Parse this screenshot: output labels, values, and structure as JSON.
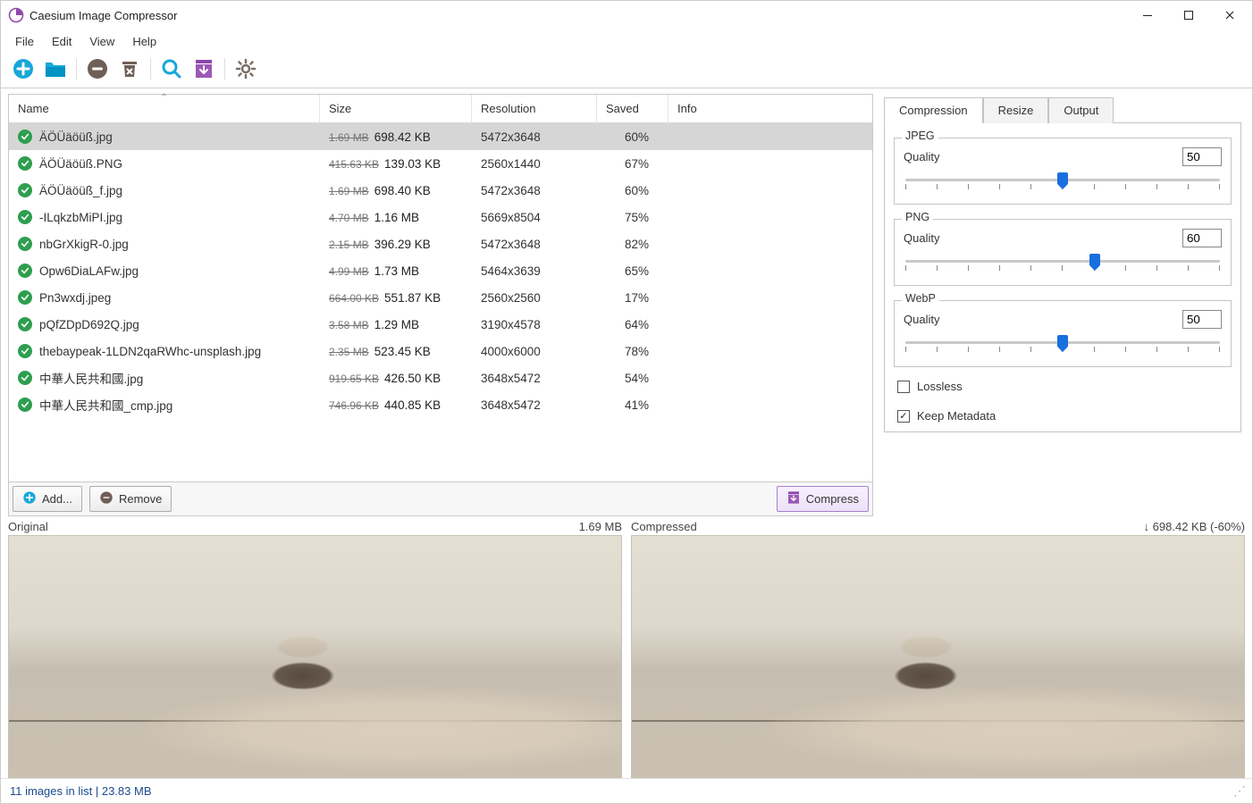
{
  "window": {
    "title": "Caesium Image Compressor"
  },
  "menu": {
    "items": [
      "File",
      "Edit",
      "View",
      "Help"
    ]
  },
  "table": {
    "headers": {
      "name": "Name",
      "size": "Size",
      "resolution": "Resolution",
      "saved": "Saved",
      "info": "Info"
    },
    "rows": [
      {
        "name": "ÄÖÜäöüß.jpg",
        "orig": "1.69 MB",
        "new": "698.42 KB",
        "res": "5472x3648",
        "saved": "60%",
        "selected": true
      },
      {
        "name": "ÄÖÜäöüß.PNG",
        "orig": "415.63 KB",
        "new": "139.03 KB",
        "res": "2560x1440",
        "saved": "67%"
      },
      {
        "name": "ÄÖÜäöüß_f.jpg",
        "orig": "1.69 MB",
        "new": "698.40 KB",
        "res": "5472x3648",
        "saved": "60%"
      },
      {
        "name": "-ILqkzbMiPI.jpg",
        "orig": "4.70 MB",
        "new": "1.16 MB",
        "res": "5669x8504",
        "saved": "75%"
      },
      {
        "name": "nbGrXkigR-0.jpg",
        "orig": "2.15 MB",
        "new": "396.29 KB",
        "res": "5472x3648",
        "saved": "82%"
      },
      {
        "name": "Opw6DiaLAFw.jpg",
        "orig": "4.99 MB",
        "new": "1.73 MB",
        "res": "5464x3639",
        "saved": "65%"
      },
      {
        "name": "Pn3wxdj.jpeg",
        "orig": "664.00 KB",
        "new": "551.87 KB",
        "res": "2560x2560",
        "saved": "17%"
      },
      {
        "name": "pQfZDpD692Q.jpg",
        "orig": "3.58 MB",
        "new": "1.29 MB",
        "res": "3190x4578",
        "saved": "64%"
      },
      {
        "name": "thebaypeak-1LDN2qaRWhc-unsplash.jpg",
        "orig": "2.35 MB",
        "new": "523.45 KB",
        "res": "4000x6000",
        "saved": "78%"
      },
      {
        "name": "中華人民共和國.jpg",
        "orig": "919.65 KB",
        "new": "426.50 KB",
        "res": "3648x5472",
        "saved": "54%"
      },
      {
        "name": "中華人民共和國_cmp.jpg",
        "orig": "746.96 KB",
        "new": "440.85 KB",
        "res": "3648x5472",
        "saved": "41%"
      }
    ]
  },
  "actions": {
    "add": "Add...",
    "remove": "Remove",
    "compress": "Compress"
  },
  "tabs": {
    "compression": "Compression",
    "resize": "Resize",
    "output": "Output",
    "active": "compression"
  },
  "compression": {
    "jpeg": {
      "legend": "JPEG",
      "quality_label": "Quality",
      "quality": "50"
    },
    "png": {
      "legend": "PNG",
      "quality_label": "Quality",
      "quality": "60"
    },
    "webp": {
      "legend": "WebP",
      "quality_label": "Quality",
      "quality": "50"
    },
    "lossless": {
      "label": "Lossless",
      "checked": false
    },
    "metadata": {
      "label": "Keep Metadata",
      "checked": true
    }
  },
  "preview": {
    "left_label": "Original",
    "left_value": "1.69 MB",
    "right_label": "Compressed",
    "right_value": "↓ 698.42 KB (-60%)"
  },
  "status": {
    "text": "11 images in list | 23.83 MB"
  }
}
